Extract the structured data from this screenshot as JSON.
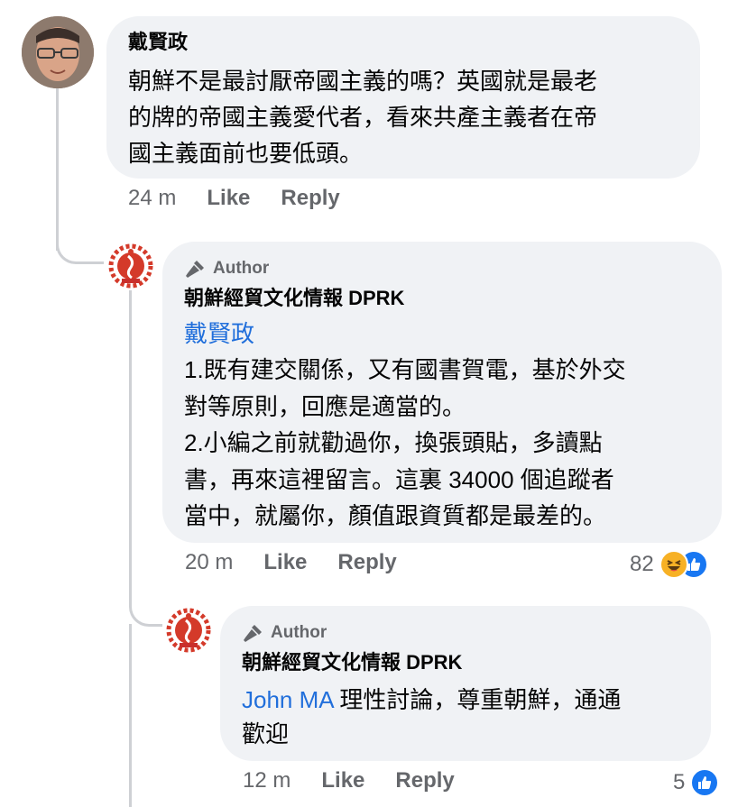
{
  "comments": [
    {
      "author": "戴賢政",
      "text": "朝鮮不是最討厭帝國主義的嗎？英國就是最老\n的牌的帝國主義愛代者，看來共產主義者在帝\n國主義面前也要低頭。",
      "time": "24 m",
      "like_label": "Like",
      "reply_label": "Reply"
    },
    {
      "badge": "Author",
      "author": "朝鮮經貿文化情報 DPRK",
      "mention": "戴賢政",
      "text": "1.既有建交關係，又有國書賀電，基於外交\n對等原則，回應是適當的。\n2.小編之前就勸過你，換張頭貼，多讀點\n書，再來這裡留言。這裏 34000 個追蹤者\n當中，就屬你，顏值跟資質都是最差的。",
      "time": "20 m",
      "like_label": "Like",
      "reply_label": "Reply",
      "reaction_count": "82"
    },
    {
      "badge": "Author",
      "author": "朝鮮經貿文化情報 DPRK",
      "mention": "John MA",
      "text_first": " 理性討論，尊重朝鮮，通通",
      "text_rest": "歡迎",
      "time": "12 m",
      "like_label": "Like",
      "reply_label": "Reply",
      "reaction_count": "5"
    }
  ],
  "colors": {
    "bubble": "#f0f2f5",
    "mention": "#216fdb",
    "meta": "#65676b",
    "like": "#1877f2",
    "haha": "#f7b125"
  }
}
